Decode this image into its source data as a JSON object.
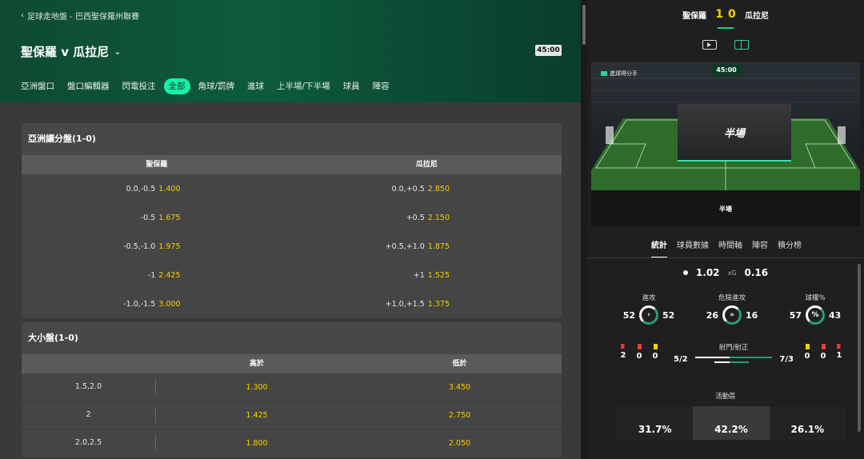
{
  "breadcrumb": {
    "text": "足球走地盤 - 巴西聖保羅州聯賽"
  },
  "match": {
    "title": "聖保羅 v 瓜拉尼",
    "clock": "45:00"
  },
  "market_tabs": [
    {
      "label": "亞洲盤口"
    },
    {
      "label": "盤口編輯器"
    },
    {
      "label": "閃電投注"
    },
    {
      "label": "全部",
      "active": true
    },
    {
      "label": "角球/罰牌"
    },
    {
      "label": "進球"
    },
    {
      "label": "上半場/下半場"
    },
    {
      "label": "球員"
    },
    {
      "label": "陣容"
    }
  ],
  "asian_handicap": {
    "title": "亞洲讓分盤(1-0)",
    "home": "聖保羅",
    "away": "瓜拉尼",
    "rows": [
      {
        "home_line": "0.0,-0.5",
        "home_odds": "1.400",
        "away_line": "0.0,+0.5",
        "away_odds": "2.850"
      },
      {
        "home_line": "-0.5",
        "home_odds": "1.675",
        "away_line": "+0.5",
        "away_odds": "2.150"
      },
      {
        "home_line": "-0.5,-1.0",
        "home_odds": "1.975",
        "away_line": "+0.5,+1.0",
        "away_odds": "1.875"
      },
      {
        "home_line": "-1",
        "home_odds": "2.425",
        "away_line": "+1",
        "away_odds": "1.525"
      },
      {
        "home_line": "-1.0,-1.5",
        "home_odds": "3.000",
        "away_line": "+1.0,+1.5",
        "away_odds": "1.375"
      }
    ]
  },
  "over_under": {
    "title": "大小盤(1-0)",
    "over": "高於",
    "under": "低於",
    "rows": [
      {
        "line": "1.5,2.0",
        "over": "1.300",
        "under": "3.450"
      },
      {
        "line": "2",
        "over": "1.425",
        "under": "2.750"
      },
      {
        "line": "2.0,2.5",
        "over": "1.800",
        "under": "2.050"
      }
    ]
  },
  "scoreboard": {
    "home": "聖保羅",
    "away": "瓜拉尼",
    "home_score": "1",
    "away_score": "0"
  },
  "media": {
    "video_icon": "play-icon",
    "pitch_icon": "pitch-icon"
  },
  "stadium": {
    "goal_label": "進球得分手",
    "clock": "45:00",
    "overlay": "半場",
    "caption": "半場"
  },
  "stats_tabs": [
    {
      "label": "統計",
      "active": true
    },
    {
      "label": "球員數據"
    },
    {
      "label": "時間軸"
    },
    {
      "label": "陣容"
    },
    {
      "label": "積分榜"
    }
  ],
  "xg": {
    "home": "1.02",
    "label": "xG",
    "away": "0.16"
  },
  "gauges": [
    {
      "name": "進攻",
      "home": "52",
      "away": "52",
      "icon": "chevron-right-icon",
      "glyph": "›"
    },
    {
      "name": "危險進攻",
      "home": "26",
      "away": "16",
      "icon": "double-chevron-icon",
      "glyph": "»"
    },
    {
      "name": "球權%",
      "home": "57",
      "away": "43",
      "icon": "percent-icon",
      "glyph": "%"
    }
  ],
  "cards": {
    "home": {
      "corners": "2",
      "red": "0",
      "yellow": "0"
    },
    "away": {
      "yellow": "0",
      "red": "0",
      "corners": "1"
    }
  },
  "shots": {
    "label": "射門/射正",
    "home": "5/2",
    "away": "7/3"
  },
  "activity": {
    "label": "活動區",
    "zones": [
      "31.7%",
      "42.2%",
      "26.1%"
    ]
  },
  "colors": {
    "accent": "#17f0a8",
    "odds": "#f5d000",
    "hero": "#0d5b3c"
  }
}
